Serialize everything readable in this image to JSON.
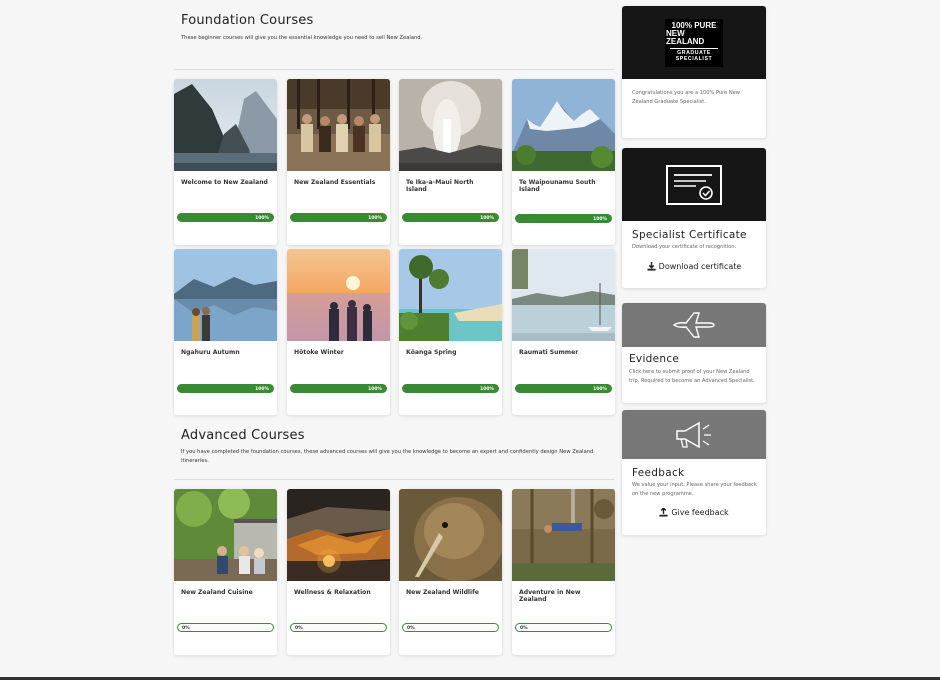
{
  "foundation": {
    "title": "Foundation Courses",
    "description": "These beginner courses will give you the essential knowledge you need to sell New Zealand.",
    "courses": [
      {
        "title": "Welcome to New Zealand",
        "progress": "100%"
      },
      {
        "title": "New Zealand Essentials",
        "progress": "100%"
      },
      {
        "title": "Te Ika-a-Maui North Island",
        "progress": "100%"
      },
      {
        "title": "Te Waipounamu South Island",
        "progress": "100%"
      },
      {
        "title": "Ngahuru Autumn",
        "progress": "100%"
      },
      {
        "title": "Hōtoke Winter",
        "progress": "100%"
      },
      {
        "title": "Kōanga Spring",
        "progress": "100%"
      },
      {
        "title": "Raumati Summer",
        "progress": "100%"
      }
    ]
  },
  "advanced": {
    "title": "Advanced Courses",
    "description": "If you have completed the foundation courses, these advanced courses will give you the knowledge to become an expert and confidently design New Zealand itineraries.",
    "courses": [
      {
        "title": "New Zealand Cuisine",
        "progress": "0%"
      },
      {
        "title": "Wellness & Relaxation",
        "progress": "0%"
      },
      {
        "title": "New Zealand Wildlife",
        "progress": "0%"
      },
      {
        "title": "Adventure in New Zealand",
        "progress": "0%"
      }
    ]
  },
  "sidebar": {
    "badge": {
      "line1": "100% PURE",
      "line2": "NEW ZEALAND",
      "line3": "GRADUATE",
      "line4": "SPECIALIST",
      "description": "Congratulations you are a 100% Pure New Zealand Graduate Specialist."
    },
    "certificate": {
      "title": "Specialist Certificate",
      "description": "Download your certificate of recognition.",
      "action": "Download certificate"
    },
    "evidence": {
      "title": "Evidence",
      "description": "Click here to submit proof of your New Zealand trip. Required to become an Advanced Specialist."
    },
    "feedback": {
      "title": "Feedback",
      "description": "We value your input. Please share your feedback on the new programme.",
      "action": "Give feedback"
    }
  },
  "colors": {
    "progress": "#3a8a35",
    "dark_tile": "#161616",
    "grey_tile": "#777777"
  }
}
